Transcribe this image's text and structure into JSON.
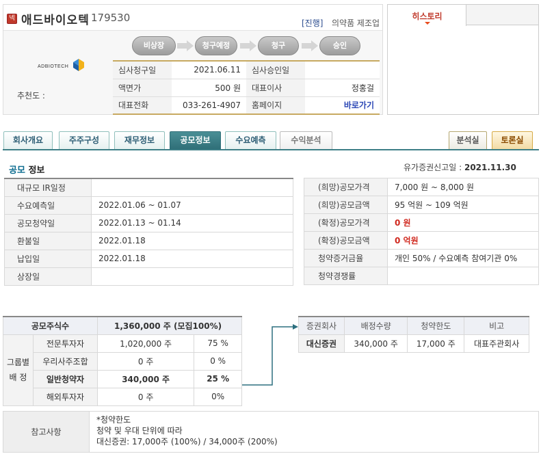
{
  "header": {
    "badge": "넥",
    "company_name": "애드바이오텍",
    "company_code": "179530",
    "status": "[진행]",
    "sector": "의약품 제조업",
    "logo_text": "ADBIOTECH",
    "recommend_label": "추천도 :"
  },
  "steps": [
    "비상장",
    "청구예정",
    "청구",
    "승인"
  ],
  "info": {
    "rows": [
      {
        "l1": "심사청구일",
        "v1": "2021.06.11",
        "l2": "심사승인일",
        "v2": ""
      },
      {
        "l1": "액면가",
        "v1": "500 원",
        "l2": "대표이사",
        "v2": "정홍걸"
      },
      {
        "l1": "대표전화",
        "v1": "033-261-4907",
        "l2": "홈페이지",
        "v2": "바로가기"
      }
    ]
  },
  "history": {
    "tab_label": "히스토리"
  },
  "tabs": [
    {
      "label": "회사개요"
    },
    {
      "label": "주주구성"
    },
    {
      "label": "재무정보"
    },
    {
      "label": "공모정보"
    },
    {
      "label": "수요예측"
    },
    {
      "label": "수익분석"
    },
    {
      "label": "분석실"
    },
    {
      "label": "토론실"
    }
  ],
  "section": {
    "title_hl": "공모",
    "title_rest": " 정보",
    "notice_label": "유가증권신고일 :",
    "notice_date": "2021.11.30"
  },
  "schedule": [
    {
      "label": "대규모 IR일정",
      "value": ""
    },
    {
      "label": "수요예측일",
      "value": "2022.01.06 ~ 01.07"
    },
    {
      "label": "공모청약일",
      "value": "2022.01.13 ~ 01.14"
    },
    {
      "label": "환불일",
      "value": "2022.01.18"
    },
    {
      "label": "납입일",
      "value": "2022.01.18"
    },
    {
      "label": "상장일",
      "value": ""
    }
  ],
  "pricing": [
    {
      "label": "(희망)공모가격",
      "value": "7,000 원 ~ 8,000 원"
    },
    {
      "label": "(희망)공모금액",
      "value": "95 억원  ~ 109 억원"
    },
    {
      "label": "(확정)공모가격",
      "value": "0 원"
    },
    {
      "label": "(확정)공모금액",
      "value": "0 억원"
    },
    {
      "label": "청약증거금율",
      "value": "개인 50% / 수요예측 참여기관 0%"
    },
    {
      "label": "청약경쟁률",
      "value": ""
    }
  ],
  "allocation": {
    "total_label": "공모주식수",
    "total_value": "1,360,000 주 (모집100%)",
    "group_label_1": "그룹별",
    "group_label_2": "배 정",
    "rows": [
      {
        "label": "전문투자자",
        "shares": "1,020,000 주",
        "pct": "75 %"
      },
      {
        "label": "우리사주조합",
        "shares": "0 주",
        "pct": "0 %"
      },
      {
        "label": "일반청약자",
        "shares": "340,000 주",
        "pct": "25 %"
      },
      {
        "label": "해외투자자",
        "shares": "0 주",
        "pct": "0%"
      }
    ]
  },
  "broker": {
    "headers": [
      "증권회사",
      "배정수량",
      "청약한도",
      "비고"
    ],
    "rows": [
      {
        "company": "대신증권",
        "qty": "340,000 주",
        "limit": "17,000 주",
        "note": "대표주관회사"
      }
    ]
  },
  "notes": {
    "label": "참고사항",
    "lines": [
      "*청약한도",
      "청약 및 우대 단위에 따라",
      "대신증권: 17,000주 (100%) / 34,000주 (200%)"
    ]
  },
  "colors": {
    "accent": "#2f6f78",
    "gold": "#c7a960",
    "red": "#d0281e"
  }
}
